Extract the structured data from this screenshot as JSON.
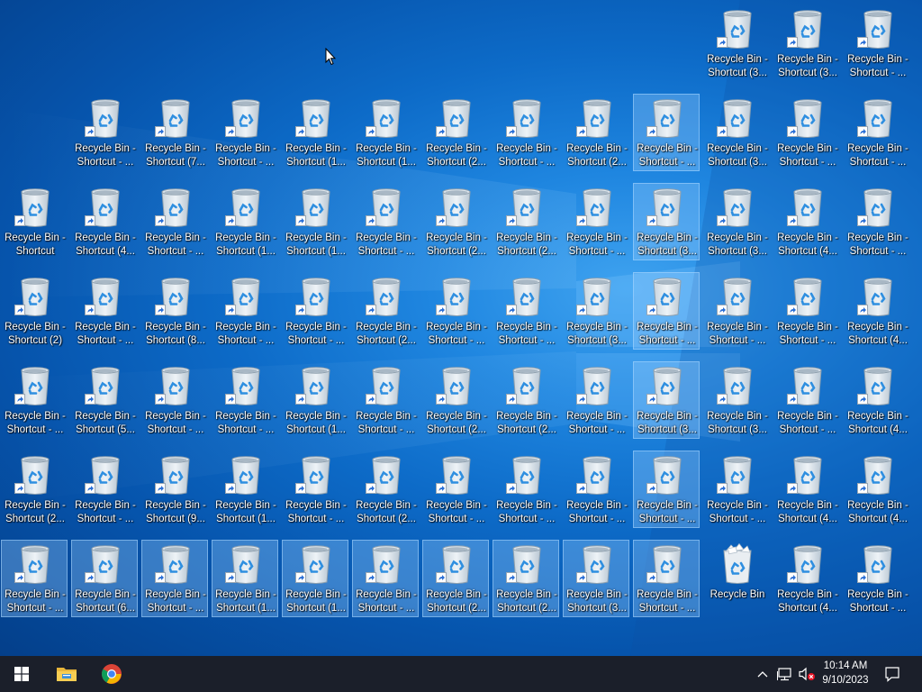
{
  "desktop": {
    "icons": [
      {
        "label": "Recycle Bin -\nShortcut (3...",
        "shortcut": true,
        "selected": false
      },
      {
        "label": "Recycle Bin -\nShortcut (3...",
        "shortcut": true,
        "selected": false
      },
      {
        "label": "Recycle Bin -\nShortcut - ...",
        "shortcut": true,
        "selected": false
      },
      {
        "label": "Recycle Bin -\nShortcut - ...",
        "shortcut": true,
        "selected": false
      },
      {
        "label": "Recycle Bin -\nShortcut (7...",
        "shortcut": true,
        "selected": false
      },
      {
        "label": "Recycle Bin -\nShortcut - ...",
        "shortcut": true,
        "selected": false
      },
      {
        "label": "Recycle Bin -\nShortcut (1...",
        "shortcut": true,
        "selected": false
      },
      {
        "label": "Recycle Bin -\nShortcut (1...",
        "shortcut": true,
        "selected": false
      },
      {
        "label": "Recycle Bin -\nShortcut (2...",
        "shortcut": true,
        "selected": false
      },
      {
        "label": "Recycle Bin -\nShortcut - ...",
        "shortcut": true,
        "selected": false
      },
      {
        "label": "Recycle Bin -\nShortcut (2...",
        "shortcut": true,
        "selected": false
      },
      {
        "label": "Recycle Bin -\nShortcut - ...",
        "shortcut": true,
        "selected": true
      },
      {
        "label": "Recycle Bin -\nShortcut (3...",
        "shortcut": true,
        "selected": false
      },
      {
        "label": "Recycle Bin -\nShortcut - ...",
        "shortcut": true,
        "selected": false
      },
      {
        "label": "Recycle Bin -\nShortcut - ...",
        "shortcut": true,
        "selected": false
      },
      {
        "label": "Recycle Bin -\nShortcut",
        "shortcut": true,
        "selected": false
      },
      {
        "label": "Recycle Bin -\nShortcut (4...",
        "shortcut": true,
        "selected": false
      },
      {
        "label": "Recycle Bin -\nShortcut - ...",
        "shortcut": true,
        "selected": false
      },
      {
        "label": "Recycle Bin -\nShortcut (1...",
        "shortcut": true,
        "selected": false
      },
      {
        "label": "Recycle Bin -\nShortcut (1...",
        "shortcut": true,
        "selected": false
      },
      {
        "label": "Recycle Bin -\nShortcut - ...",
        "shortcut": true,
        "selected": false
      },
      {
        "label": "Recycle Bin -\nShortcut (2...",
        "shortcut": true,
        "selected": false
      },
      {
        "label": "Recycle Bin -\nShortcut (2...",
        "shortcut": true,
        "selected": false
      },
      {
        "label": "Recycle Bin -\nShortcut - ...",
        "shortcut": true,
        "selected": false
      },
      {
        "label": "Recycle Bin -\nShortcut (3...",
        "shortcut": true,
        "selected": true
      },
      {
        "label": "Recycle Bin -\nShortcut (3...",
        "shortcut": true,
        "selected": false
      },
      {
        "label": "Recycle Bin -\nShortcut (4...",
        "shortcut": true,
        "selected": false
      },
      {
        "label": "Recycle Bin -\nShortcut - ...",
        "shortcut": true,
        "selected": false
      },
      {
        "label": "Recycle Bin -\nShortcut (2)",
        "shortcut": true,
        "selected": false
      },
      {
        "label": "Recycle Bin -\nShortcut - ...",
        "shortcut": true,
        "selected": false
      },
      {
        "label": "Recycle Bin -\nShortcut (8...",
        "shortcut": true,
        "selected": false
      },
      {
        "label": "Recycle Bin -\nShortcut - ...",
        "shortcut": true,
        "selected": false
      },
      {
        "label": "Recycle Bin -\nShortcut - ...",
        "shortcut": true,
        "selected": false
      },
      {
        "label": "Recycle Bin -\nShortcut (2...",
        "shortcut": true,
        "selected": false
      },
      {
        "label": "Recycle Bin -\nShortcut - ...",
        "shortcut": true,
        "selected": false
      },
      {
        "label": "Recycle Bin -\nShortcut - ...",
        "shortcut": true,
        "selected": false
      },
      {
        "label": "Recycle Bin -\nShortcut (3...",
        "shortcut": true,
        "selected": false
      },
      {
        "label": "Recycle Bin -\nShortcut - ...",
        "shortcut": true,
        "selected": true
      },
      {
        "label": "Recycle Bin -\nShortcut - ...",
        "shortcut": true,
        "selected": false
      },
      {
        "label": "Recycle Bin -\nShortcut - ...",
        "shortcut": true,
        "selected": false
      },
      {
        "label": "Recycle Bin -\nShortcut (4...",
        "shortcut": true,
        "selected": false
      },
      {
        "label": "Recycle Bin -\nShortcut - ...",
        "shortcut": true,
        "selected": false
      },
      {
        "label": "Recycle Bin -\nShortcut (5...",
        "shortcut": true,
        "selected": false
      },
      {
        "label": "Recycle Bin -\nShortcut - ...",
        "shortcut": true,
        "selected": false
      },
      {
        "label": "Recycle Bin -\nShortcut - ...",
        "shortcut": true,
        "selected": false
      },
      {
        "label": "Recycle Bin -\nShortcut (1...",
        "shortcut": true,
        "selected": false
      },
      {
        "label": "Recycle Bin -\nShortcut - ...",
        "shortcut": true,
        "selected": false
      },
      {
        "label": "Recycle Bin -\nShortcut (2...",
        "shortcut": true,
        "selected": false
      },
      {
        "label": "Recycle Bin -\nShortcut (2...",
        "shortcut": true,
        "selected": false
      },
      {
        "label": "Recycle Bin -\nShortcut - ...",
        "shortcut": true,
        "selected": false
      },
      {
        "label": "Recycle Bin -\nShortcut (3...",
        "shortcut": true,
        "selected": true
      },
      {
        "label": "Recycle Bin -\nShortcut (3...",
        "shortcut": true,
        "selected": false
      },
      {
        "label": "Recycle Bin -\nShortcut - ...",
        "shortcut": true,
        "selected": false
      },
      {
        "label": "Recycle Bin -\nShortcut (4...",
        "shortcut": true,
        "selected": false
      },
      {
        "label": "Recycle Bin -\nShortcut (2...",
        "shortcut": true,
        "selected": false
      },
      {
        "label": "Recycle Bin -\nShortcut - ...",
        "shortcut": true,
        "selected": false
      },
      {
        "label": "Recycle Bin -\nShortcut (9...",
        "shortcut": true,
        "selected": false
      },
      {
        "label": "Recycle Bin -\nShortcut (1...",
        "shortcut": true,
        "selected": false
      },
      {
        "label": "Recycle Bin -\nShortcut - ...",
        "shortcut": true,
        "selected": false
      },
      {
        "label": "Recycle Bin -\nShortcut (2...",
        "shortcut": true,
        "selected": false
      },
      {
        "label": "Recycle Bin -\nShortcut - ...",
        "shortcut": true,
        "selected": false
      },
      {
        "label": "Recycle Bin -\nShortcut - ...",
        "shortcut": true,
        "selected": false
      },
      {
        "label": "Recycle Bin -\nShortcut - ...",
        "shortcut": true,
        "selected": false
      },
      {
        "label": "Recycle Bin -\nShortcut - ...",
        "shortcut": true,
        "selected": true
      },
      {
        "label": "Recycle Bin -\nShortcut - ...",
        "shortcut": true,
        "selected": false
      },
      {
        "label": "Recycle Bin -\nShortcut (4...",
        "shortcut": true,
        "selected": false
      },
      {
        "label": "Recycle Bin -\nShortcut (4...",
        "shortcut": true,
        "selected": false
      },
      {
        "label": "Recycle Bin -\nShortcut - ...",
        "shortcut": true,
        "selected": true
      },
      {
        "label": "Recycle Bin -\nShortcut (6...",
        "shortcut": true,
        "selected": true
      },
      {
        "label": "Recycle Bin -\nShortcut - ...",
        "shortcut": true,
        "selected": true
      },
      {
        "label": "Recycle Bin -\nShortcut (1...",
        "shortcut": true,
        "selected": true
      },
      {
        "label": "Recycle Bin -\nShortcut (1...",
        "shortcut": true,
        "selected": true
      },
      {
        "label": "Recycle Bin -\nShortcut - ...",
        "shortcut": true,
        "selected": true
      },
      {
        "label": "Recycle Bin -\nShortcut (2...",
        "shortcut": true,
        "selected": true
      },
      {
        "label": "Recycle Bin -\nShortcut (2...",
        "shortcut": true,
        "selected": true
      },
      {
        "label": "Recycle Bin -\nShortcut (3...",
        "shortcut": true,
        "selected": true
      },
      {
        "label": "Recycle Bin -\nShortcut - ...",
        "shortcut": true,
        "selected": true
      },
      {
        "label": "Recycle Bin",
        "shortcut": false,
        "selected": false
      },
      {
        "label": "Recycle Bin -\nShortcut (4...",
        "shortcut": true,
        "selected": false
      },
      {
        "label": "Recycle Bin -\nShortcut - ...",
        "shortcut": true,
        "selected": false
      }
    ]
  },
  "taskbar": {
    "pinned": [
      "start-icon",
      "file-explorer-icon",
      "chrome-icon"
    ],
    "tray": {
      "icons": [
        "chevron-up-icon",
        "network-icon",
        "volume-muted-icon",
        "notification-icon"
      ]
    },
    "clock": {
      "time": "10:14 AM",
      "date": "9/10/2023"
    }
  },
  "colors": {
    "taskbar": "#1b1f2a",
    "desktop_blue": "#0d6bc8",
    "bin_accent": "#2f8fe0",
    "selection": "#99ceff"
  }
}
